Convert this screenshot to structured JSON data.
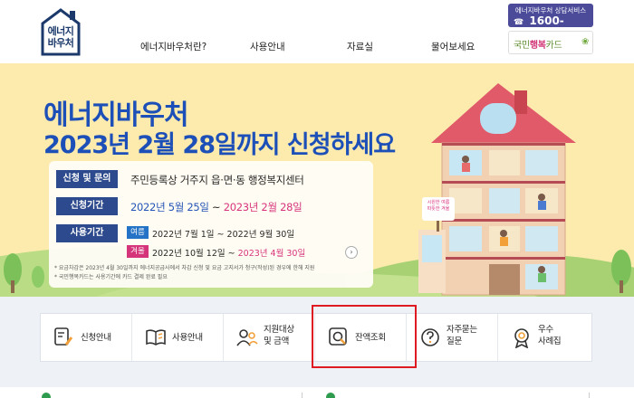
{
  "logo": {
    "line1": "에너지",
    "line2": "바우처"
  },
  "nav": [
    "에너지바우처란?",
    "사용안내",
    "자료실",
    "물어보세요"
  ],
  "hotline": {
    "label": "에너지바우처 상담서비스",
    "number": "1600-3190"
  },
  "card": {
    "prefix": "국민",
    "highlight": "행복",
    "suffix": "카드"
  },
  "banner": {
    "title_line1": "에너지바우처",
    "title_line2": "2023년 2월 28일까지 신청하세요",
    "rows": {
      "inquiry_tag": "신청 및 문의",
      "inquiry_text": "주민등록상 거주지 읍·면·동 행정복지센터",
      "period_tag": "신청기간",
      "period_start": "2022년 5월 25일",
      "period_sep": " ~ ",
      "period_end": "2023년 2월 28일",
      "usage_tag": "사용기간",
      "summer_tag": "여름",
      "summer_text": "2022년 7월 1일 ~ 2022년 9월 30일",
      "winter_tag": "겨울",
      "winter_text_a": "2022년 10월 12일 ~ ",
      "winter_text_b": "2023년 4월 30일"
    },
    "note1": "* 요금차감은 2023년 4월 30일까지 에너지공급사에서 차감 신청 및 요금 고지서가 청구(작성)된 경우에 한해 지원",
    "note2": "* 국민행복카드는 사용기간에 카드 결제 완료 필요",
    "sign_text": "시원한 여름\n따뜻한 겨울"
  },
  "quick_menu": [
    {
      "label": "신청안내",
      "icon": "document-pen-icon"
    },
    {
      "label": "사용안내",
      "icon": "open-book-icon"
    },
    {
      "label": "지원대상\n및 금액",
      "icon": "people-icon"
    },
    {
      "label": "잔액조회",
      "icon": "magnifier-icon"
    },
    {
      "label": "자주묻는\n질문",
      "icon": "question-icon"
    },
    {
      "label": "우수\n사례집",
      "icon": "award-icon"
    }
  ],
  "colors": {
    "brand_blue": "#1d4fb8",
    "navy": "#24448c",
    "pink": "#d72d7a",
    "banner_bg": "#fcebad",
    "highlight_red": "#e01a22"
  }
}
